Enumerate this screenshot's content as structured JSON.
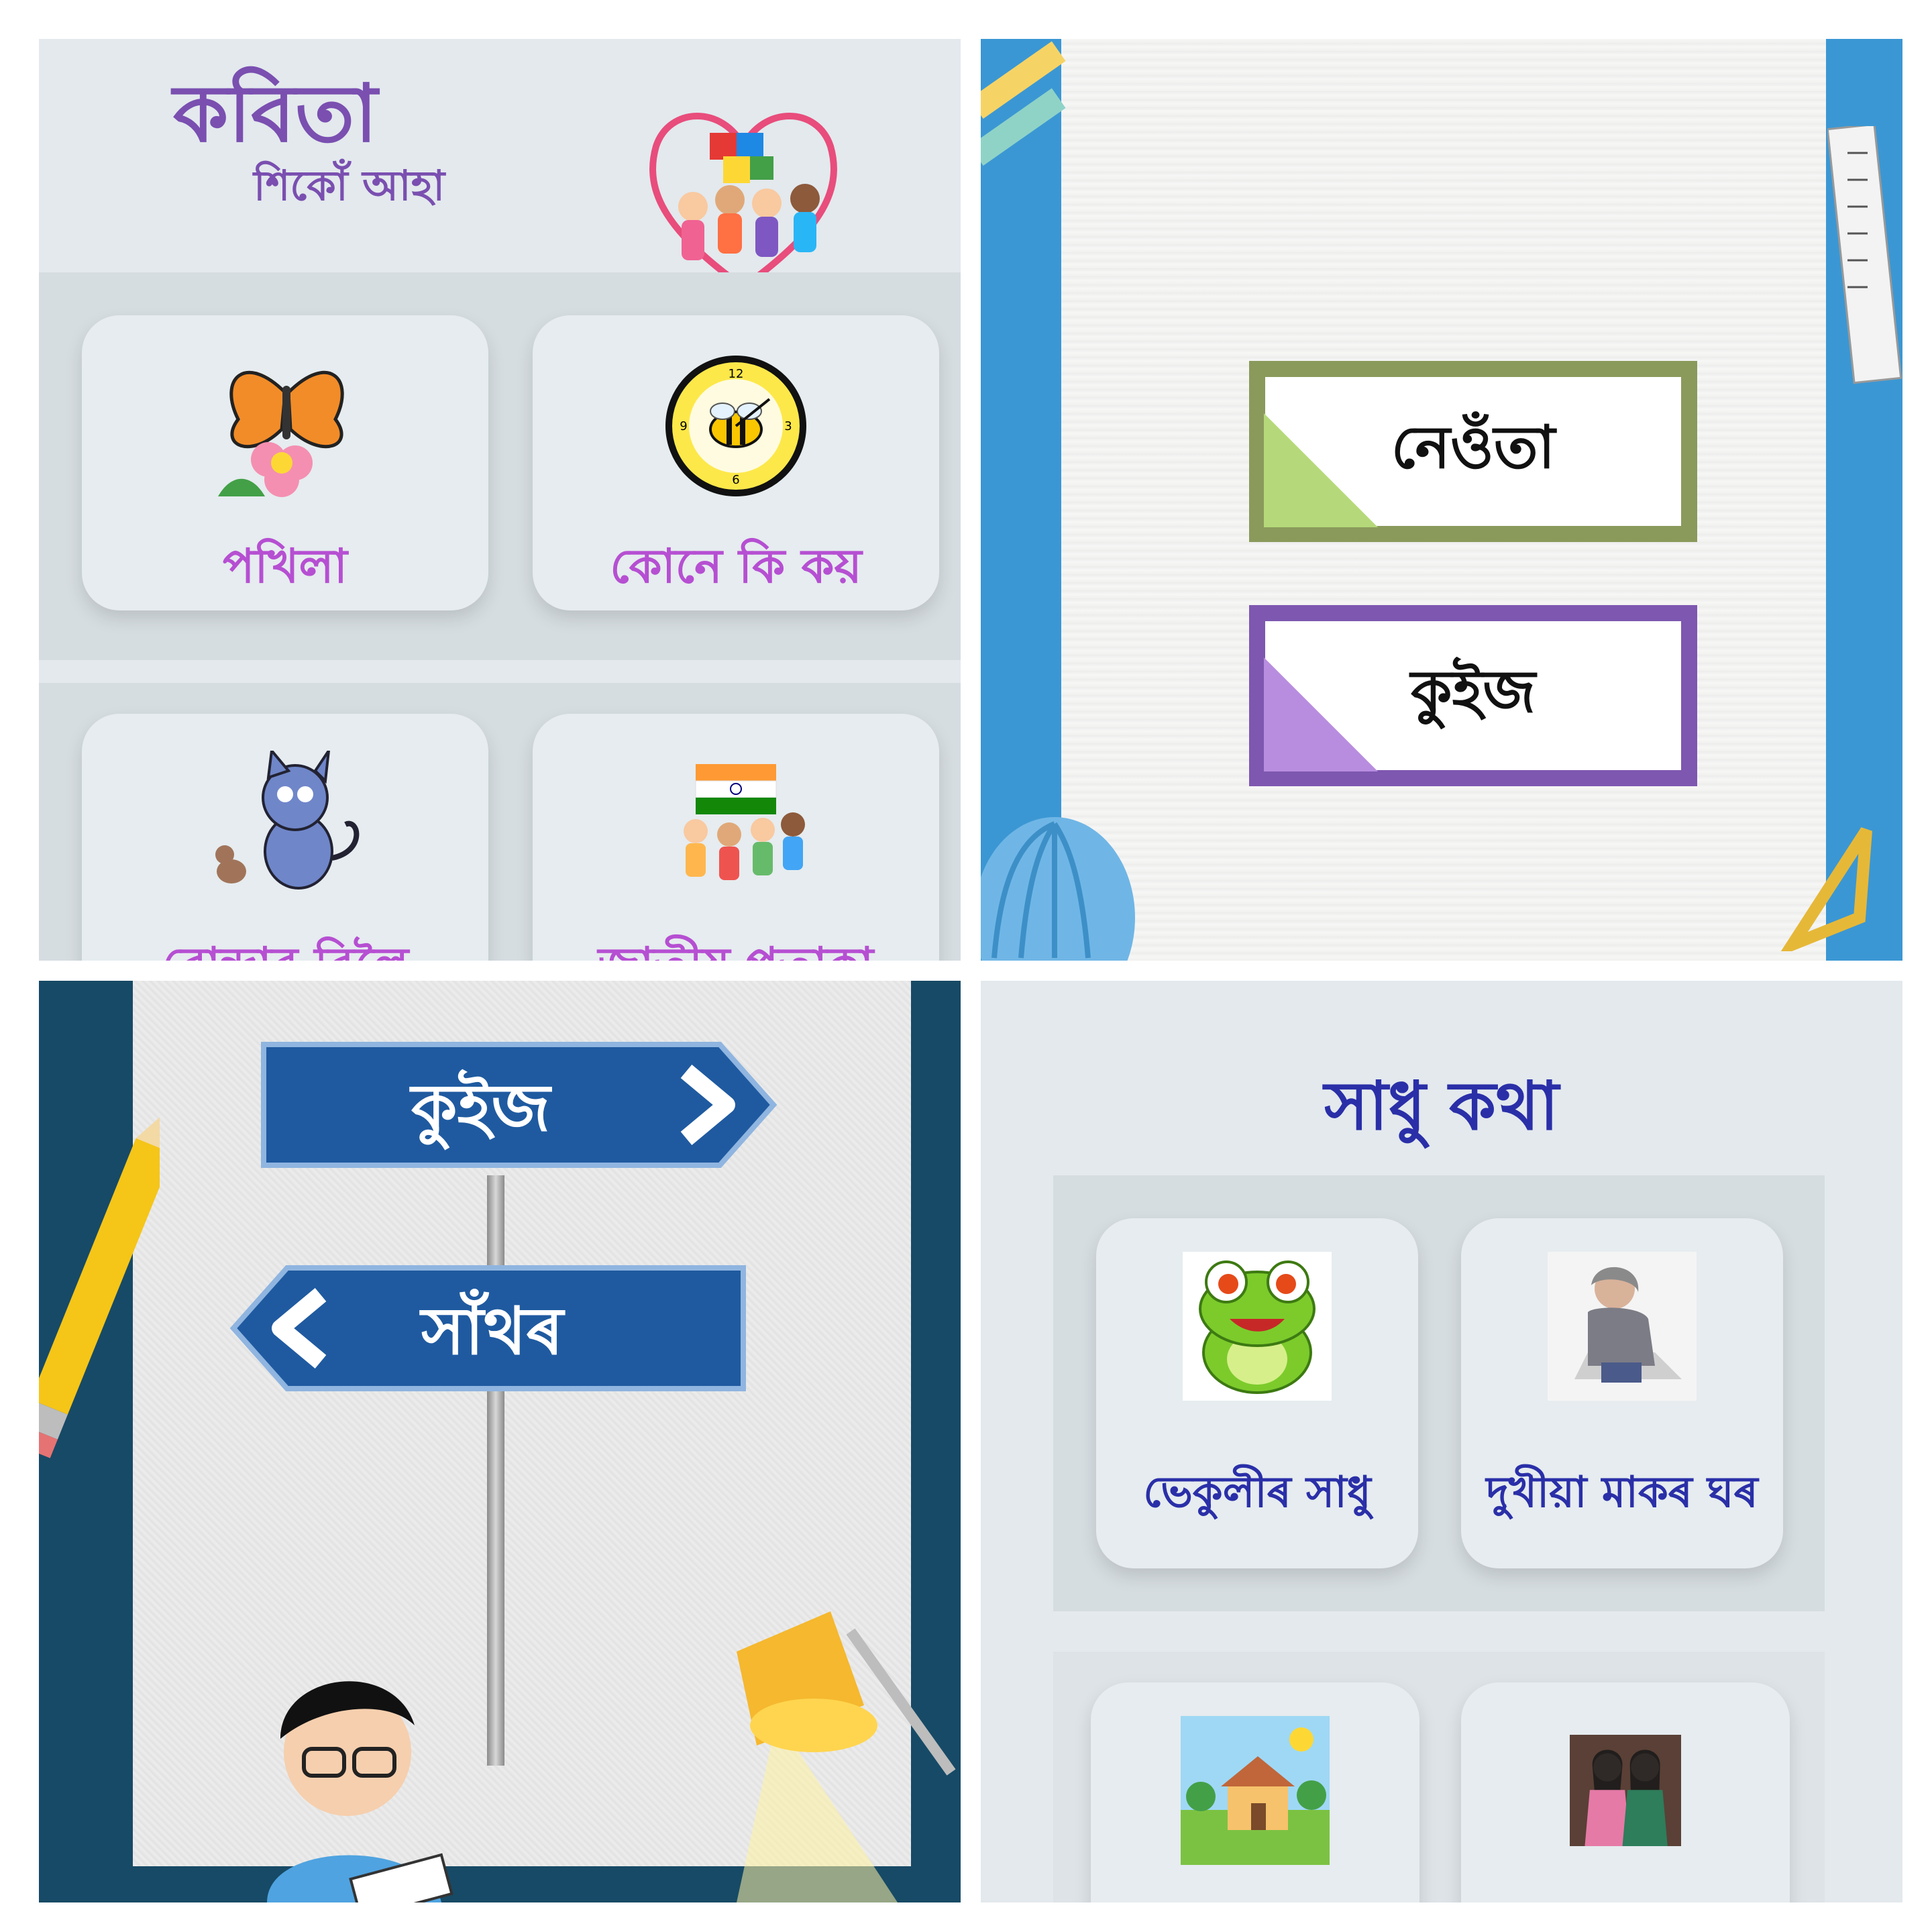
{
  "kobita": {
    "title": "কবিতা",
    "subtitle": "শিকোঁ আহা",
    "cards": [
      {
        "label": "পখিলা",
        "icon": "butterfly-flower-icon"
      },
      {
        "label": "কোনে কি কয়",
        "icon": "bee-clock-icon"
      },
      {
        "label": "বোন্দাৰ বিলৈ",
        "icon": "cat-mouse-icon"
      },
      {
        "label": "জাতীয় পতাকা",
        "icon": "children-flag-icon"
      }
    ]
  },
  "menu": {
    "invite_label": "নেওঁতা",
    "quiz_label": "কুইজ"
  },
  "signpost": {
    "quiz_label": "কুইজ",
    "answer_label": "সাঁথৰ"
  },
  "sadhu": {
    "title": "সাধু কথা",
    "cards": [
      {
        "label": "ভেকুলীৰ সাধু",
        "icon": "frog-icon"
      },
      {
        "label": "দুখীয়া মাকৰ ঘৰ",
        "icon": "old-woman-icon"
      },
      {
        "label": "",
        "icon": "village-house-icon"
      },
      {
        "label": "",
        "icon": "two-women-icon"
      }
    ]
  },
  "colors": {
    "purple": "#7a4fb0",
    "magenta": "#b64fd2",
    "navy": "#2a2fa8",
    "sky": "#3b97d3",
    "sign_blue": "#1f5aa0"
  }
}
